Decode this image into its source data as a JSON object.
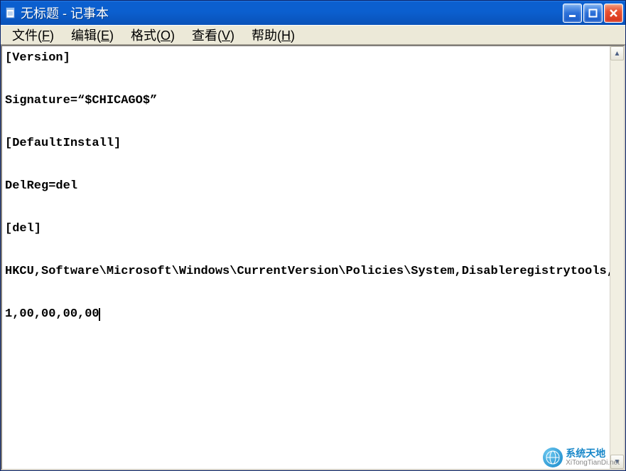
{
  "title": "无标题 - 记事本",
  "menus": {
    "file": {
      "label": "文件",
      "mnemonic": "F"
    },
    "edit": {
      "label": "编辑",
      "mnemonic": "E"
    },
    "format": {
      "label": "格式",
      "mnemonic": "O"
    },
    "view": {
      "label": "查看",
      "mnemonic": "V"
    },
    "help": {
      "label": "帮助",
      "mnemonic": "H"
    }
  },
  "document_lines": [
    "[Version]",
    "",
    "Signature=“$CHICAGO$”",
    "",
    "[DefaultInstall]",
    "",
    "DelReg=del",
    "",
    "[del]",
    "",
    "HKCU,Software\\Microsoft\\Windows\\CurrentVersion\\Policies\\System,Disableregistrytools,",
    "",
    "1,00,00,00,00"
  ],
  "watermark": {
    "cn": "系统天地",
    "en": "XiTongTianDi.net"
  }
}
